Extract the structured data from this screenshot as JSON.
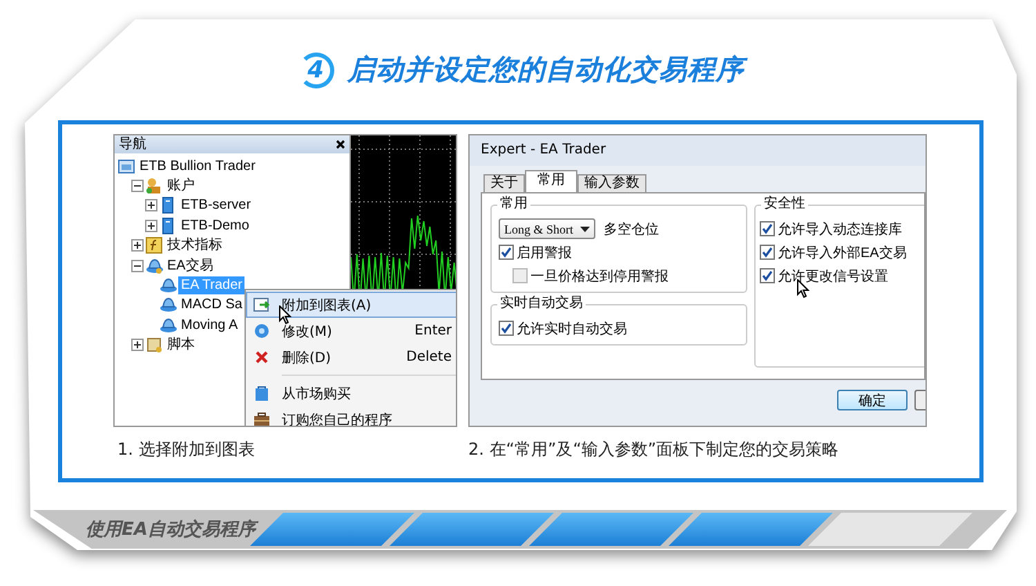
{
  "title": {
    "number": "4",
    "text": "启动并设定您的自动化交易程序"
  },
  "navigator": {
    "title": "导航",
    "tree": [
      {
        "label": "ETB Bullion Trader",
        "kind": "root",
        "selected": false,
        "children": [
          {
            "label": "账户",
            "kind": "accounts",
            "expanded": true,
            "selected": false,
            "children": [
              {
                "label": "ETB-server",
                "kind": "account",
                "expanded": false,
                "selected": false
              },
              {
                "label": "ETB-Demo",
                "kind": "account",
                "expanded": false,
                "selected": false
              }
            ]
          },
          {
            "label": "技术指标",
            "kind": "indicators",
            "expanded": false,
            "selected": false
          },
          {
            "label": "EA交易",
            "kind": "experts",
            "expanded": true,
            "selected": false,
            "children": [
              {
                "label": "EA Trader",
                "kind": "expert",
                "selected": true
              },
              {
                "label": "MACD Sa",
                "kind": "expert",
                "selected": false
              },
              {
                "label": "Moving A",
                "kind": "expert",
                "selected": false
              }
            ]
          },
          {
            "label": "脚本",
            "kind": "scripts",
            "expanded": false,
            "selected": false
          }
        ]
      }
    ]
  },
  "context_menu": {
    "groups": [
      {
        "items": [
          {
            "label": "附加到图表(A)",
            "kind": "attach",
            "selected": true
          },
          {
            "label": "修改(M)",
            "kind": "modify",
            "shortcut": "Enter",
            "selected": false
          },
          {
            "label": "删除(D)",
            "kind": "delete",
            "shortcut": "Delete",
            "selected": false
          }
        ]
      },
      {
        "items": [
          {
            "label": "从市场购买",
            "kind": "buy",
            "selected": false
          },
          {
            "label": "订购您自己的程序",
            "kind": "order",
            "selected": false
          }
        ]
      }
    ]
  },
  "dialog": {
    "title": "Expert - EA Trader",
    "tabs": [
      {
        "label": "关于",
        "selected": false
      },
      {
        "label": "常用",
        "selected": true
      },
      {
        "label": "输入参数",
        "selected": false
      }
    ],
    "left_groups": [
      {
        "title": "常用",
        "rows": [
          {
            "kind": "select",
            "value": "Long & Short",
            "label": "多空仓位"
          },
          {
            "kind": "checkbox",
            "label": "启用警报",
            "checked": true,
            "children": [
              {
                "kind": "checkbox",
                "label": "一旦价格达到停用警报",
                "checked": false
              }
            ]
          }
        ]
      },
      {
        "title": "实时自动交易",
        "rows": [
          {
            "kind": "checkbox",
            "label": "允许实时自动交易",
            "checked": true
          }
        ]
      }
    ],
    "right_groups": [
      {
        "title": "安全性",
        "rows": [
          {
            "kind": "checkbox",
            "label": "允许导入动态连接库",
            "checked": true
          },
          {
            "kind": "checkbox",
            "label": "允许导入外部EA交易",
            "checked": true
          },
          {
            "kind": "checkbox",
            "label": "允许更改信号设置",
            "checked": true
          }
        ]
      }
    ],
    "buttons": [
      "确定"
    ]
  },
  "captions": [
    "1. 选择附加到图表",
    "2. 在“常用”及“输入参数”面板下制定您的交易策略"
  ],
  "footer": {
    "label": "使用EA自动交易程序",
    "steps": [
      {
        "filled": true
      },
      {
        "filled": true
      },
      {
        "filled": true
      },
      {
        "filled": true
      },
      {
        "filled": false
      }
    ]
  }
}
